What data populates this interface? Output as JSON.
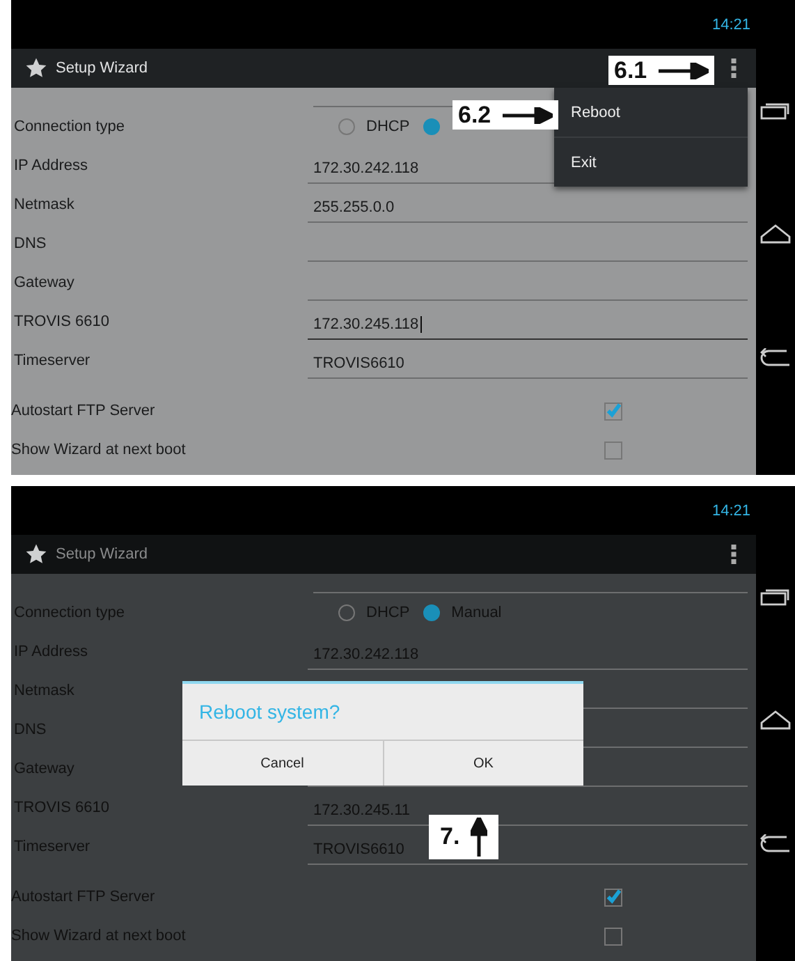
{
  "screens": [
    {
      "time": "14:21",
      "title": "Setup Wizard",
      "rows": [
        {
          "kind": "radio",
          "label": "Connection type",
          "options": [
            {
              "label": "DHCP",
              "selected": false
            },
            {
              "selected": true
            }
          ]
        },
        {
          "kind": "field",
          "label": "IP Address",
          "value": "172.30.242.118",
          "focused": false
        },
        {
          "kind": "field",
          "label": "Netmask",
          "value": "255.255.0.0",
          "focused": false
        },
        {
          "kind": "field",
          "label": "DNS",
          "focused": false
        },
        {
          "kind": "field",
          "label": "Gateway",
          "focused": false
        },
        {
          "kind": "field",
          "label": "TROVIS 6610",
          "value": "172.30.245.118",
          "focused": true
        },
        {
          "kind": "field",
          "label": "Timeserver",
          "value": "TROVIS6610",
          "focused": false
        },
        {
          "kind": "checkbox",
          "label": "Autostart FTP Server",
          "checked": true
        },
        {
          "kind": "checkbox",
          "label": "Show Wizard at next boot",
          "checked": false
        }
      ],
      "menu": {
        "items": [
          "Reboot",
          "Exit"
        ]
      },
      "callouts": [
        {
          "kind": "arrow-right",
          "label": "6.1"
        },
        {
          "kind": "arrow-right",
          "label": "6.2"
        }
      ]
    },
    {
      "time": "14:21",
      "title": "Setup Wizard",
      "rows": [
        {
          "kind": "radio",
          "label": "Connection type",
          "options": [
            {
              "label": "DHCP",
              "selected": false
            },
            {
              "label": "Manual",
              "selected": true
            }
          ]
        },
        {
          "kind": "field",
          "label": "IP Address",
          "value": "172.30.242.118",
          "focused": false
        },
        {
          "kind": "field",
          "label": "Netmask",
          "focused": false
        },
        {
          "kind": "field",
          "label": "DNS",
          "focused": false
        },
        {
          "kind": "field",
          "label": "Gateway",
          "focused": false
        },
        {
          "kind": "field",
          "label": "TROVIS 6610",
          "value": "172.30.245.11",
          "focused": false
        },
        {
          "kind": "field",
          "label": "Timeserver",
          "value": "TROVIS6610",
          "focused": false
        },
        {
          "kind": "checkbox",
          "label": "Autostart FTP Server",
          "checked": true
        },
        {
          "kind": "checkbox",
          "label": "Show Wizard at next boot",
          "checked": false
        }
      ],
      "dialog": {
        "title": "Reboot system?",
        "buttons": [
          "Cancel",
          "OK"
        ]
      },
      "callouts": [
        {
          "kind": "arrow-up",
          "label": "7."
        }
      ]
    }
  ]
}
